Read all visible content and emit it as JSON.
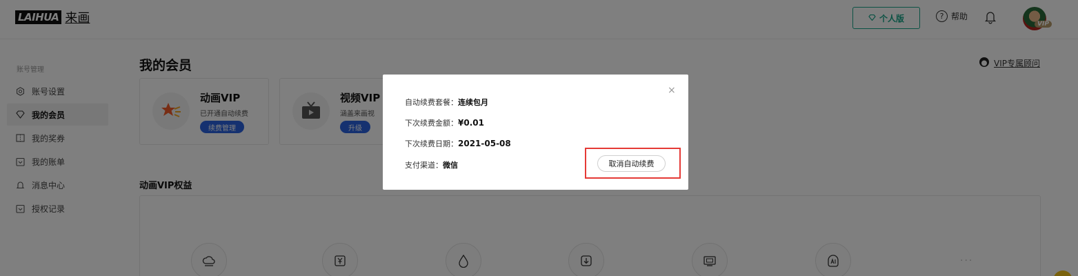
{
  "brand": {
    "logo_text": "LAIHUA",
    "logo_cn": "来画"
  },
  "header": {
    "edition_label": "个人版",
    "help_label": "帮助",
    "vip_badge": "VIP"
  },
  "sidebar": {
    "section_title": "账号管理",
    "items": [
      {
        "label": "账号设置",
        "icon": "gear-icon"
      },
      {
        "label": "我的会员",
        "icon": "diamond-icon",
        "active": true
      },
      {
        "label": "我的奖券",
        "icon": "ticket-icon"
      },
      {
        "label": "我的账单",
        "icon": "bill-icon"
      },
      {
        "label": "消息中心",
        "icon": "bell-icon"
      },
      {
        "label": "授权记录",
        "icon": "record-icon"
      }
    ]
  },
  "main": {
    "title": "我的会员",
    "consult_label": "VIP专属顾问",
    "cards": [
      {
        "name": "动画VIP",
        "desc": "已开通自动续费",
        "button": "续费管理"
      },
      {
        "name": "视频VIP",
        "desc": "涵盖来画视",
        "button": "升级"
      }
    ],
    "benefits_title": "动画VIP权益",
    "more": "···"
  },
  "modal": {
    "close": "×",
    "rows": [
      {
        "label": "自动续费套餐：",
        "value": "连续包月"
      },
      {
        "label": "下次续费金额：",
        "value": "¥0.01"
      },
      {
        "label": "下次续费日期：",
        "value": "2021-05-08"
      },
      {
        "label": "支付渠道：",
        "value": "微信"
      }
    ],
    "cancel_button": "取消自动续费"
  },
  "colors": {
    "accent": "#17a589",
    "primary_button": "#2a63e0",
    "highlight": "#e53935"
  }
}
